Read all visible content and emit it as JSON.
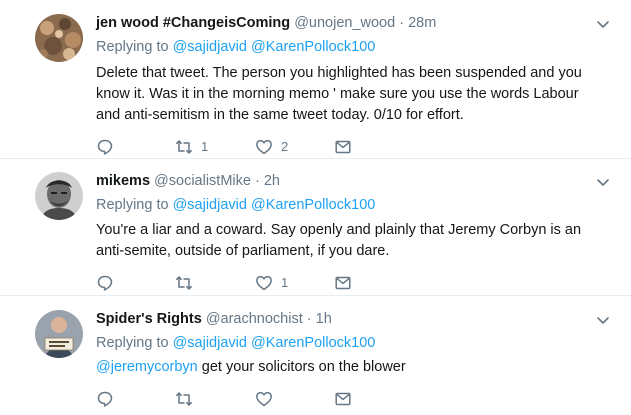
{
  "tweets": [
    {
      "name": "jen wood #ChangeisComing",
      "handle": "@unojen_wood",
      "sep": " · ",
      "time": "28m",
      "replying_label": "Replying to",
      "reply_to": [
        "@sajidjavid",
        "@KarenPollock100"
      ],
      "text": "Delete that tweet. The person you highlighted has been suspended  and you know it. Was it in the morning memo ' make sure you use the words Labour and anti-semitism in the same tweet today. 0/10 for effort.",
      "replies": "",
      "retweets": "1",
      "likes": "2"
    },
    {
      "name": "mikems",
      "handle": "@socialistMike",
      "sep": " · ",
      "time": "2h",
      "replying_label": "Replying to",
      "reply_to": [
        "@sajidjavid",
        "@KarenPollock100"
      ],
      "text": "You're a liar and a coward. Say openly and plainly that Jeremy Corbyn is an anti-semite, outside of parliament, if you dare.",
      "replies": "",
      "retweets": "",
      "likes": "1"
    },
    {
      "name": "Spider's Rights",
      "handle": "@arachnochist",
      "sep": " · ",
      "time": "1h",
      "replying_label": "Replying to",
      "reply_to": [
        "@sajidjavid",
        "@KarenPollock100"
      ],
      "mention": "@jeremycorbyn",
      "text": " get your solicitors on the blower",
      "replies": "",
      "retweets": "",
      "likes": ""
    }
  ],
  "colors": {
    "link": "#1da1f2",
    "meta": "#657786",
    "text": "#14171a",
    "divider": "#e6ecf0"
  },
  "icons": [
    "reply-icon",
    "retweet-icon",
    "like-icon",
    "message-icon",
    "chevron-down-icon"
  ]
}
